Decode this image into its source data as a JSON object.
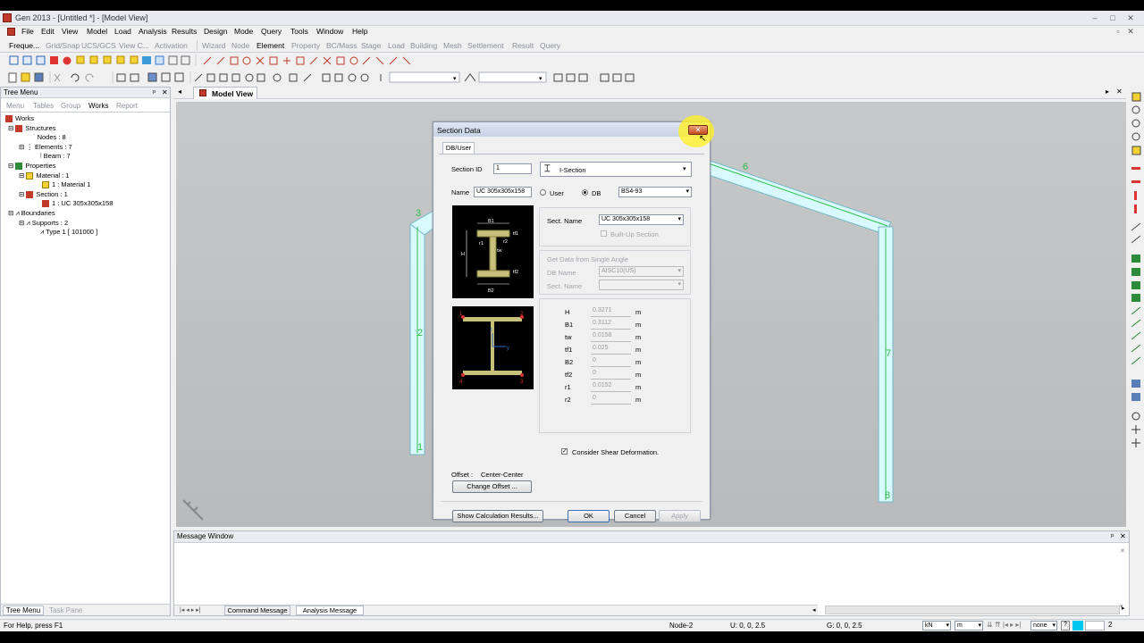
{
  "window": {
    "title": "Gen 2013 - [Untitled *] - [Model View]"
  },
  "menu": [
    "File",
    "Edit",
    "View",
    "Model",
    "Load",
    "Analysis",
    "Results",
    "Design",
    "Mode",
    "Query",
    "Tools",
    "Window",
    "Help"
  ],
  "ribbon_tabs": [
    "Freque...",
    "Grid/Snap",
    "UCS/GCS",
    "View C...",
    "Activation",
    "Wizard",
    "Node",
    "Element",
    "Property",
    "BC/Mass",
    "Stage",
    "Load",
    "Building",
    "Mesh",
    "Settlement",
    "Result",
    "Query"
  ],
  "tree": {
    "title": "Tree Menu",
    "tabs": [
      "Menu",
      "Tables",
      "Group",
      "Works",
      "Report"
    ],
    "items": [
      {
        "label": "Works",
        "level": 0
      },
      {
        "label": "Structures",
        "level": 1
      },
      {
        "label": "Nodes : 8",
        "level": 2
      },
      {
        "label": "Elements : 7",
        "level": 2
      },
      {
        "label": "Beam : 7",
        "level": 3
      },
      {
        "label": "Properties",
        "level": 1
      },
      {
        "label": "Material : 1",
        "level": 2
      },
      {
        "label": "1 : Material 1",
        "level": 3
      },
      {
        "label": "Section : 1",
        "level": 2
      },
      {
        "label": "1 : UC 305x305x158",
        "level": 3
      },
      {
        "label": "Boundaries",
        "level": 1
      },
      {
        "label": "Supports : 2",
        "level": 2
      },
      {
        "label": "Type 1 [ 101000 ]",
        "level": 3
      }
    ],
    "bottom_tabs": [
      "Tree Menu",
      "Task Pane"
    ]
  },
  "view": {
    "tab": "Model View",
    "labels": [
      "3",
      "2",
      "1",
      "7",
      "8",
      "6"
    ]
  },
  "dialog": {
    "title": "Section Data",
    "tab": "DB/User",
    "section_id_label": "Section ID",
    "section_id": "1",
    "section_type": "I-Section",
    "name_label": "Name",
    "name": "UC 305x305x158",
    "user_label": "User",
    "db_label": "DB",
    "db_value": "BS4-93",
    "sect_name_label": "Sect. Name",
    "sect_name": "UC 305x305x158",
    "builtup": "Built-Up Section",
    "single_angle": "Get Data from Single Angle",
    "db_name_label": "DB Name",
    "db_name": "AISC10(US)",
    "sect_name2_label": "Sect. Name",
    "dims": [
      {
        "name": "H",
        "value": "0.3271",
        "unit": "m"
      },
      {
        "name": "B1",
        "value": "0.3112",
        "unit": "m"
      },
      {
        "name": "tw",
        "value": "0.0158",
        "unit": "m"
      },
      {
        "name": "tf1",
        "value": "0.025",
        "unit": "m"
      },
      {
        "name": "B2",
        "value": "0",
        "unit": "m"
      },
      {
        "name": "tf2",
        "value": "0",
        "unit": "m"
      },
      {
        "name": "r1",
        "value": "0.0152",
        "unit": "m"
      },
      {
        "name": "r2",
        "value": "0",
        "unit": "m"
      }
    ],
    "diagram_labels": [
      "B1",
      "tf1",
      "r1",
      "r2",
      "H",
      "tw",
      "tf2",
      "B2"
    ],
    "axis_labels": [
      "1",
      "2",
      "3",
      "4",
      "z",
      "y"
    ],
    "shear": "Consider Shear Deformation.",
    "offset_label": "Offset :",
    "offset_value": "Center-Center",
    "change_offset": "Change Offset ...",
    "show_calc": "Show Calculation Results...",
    "ok": "OK",
    "cancel": "Cancel",
    "apply": "Apply"
  },
  "message": {
    "title": "Message Window",
    "tabs": [
      "Command Message",
      "Analysis Message"
    ]
  },
  "status": {
    "help": "For Help, press F1",
    "node": "Node-2",
    "u": "U: 0, 0, 2.5",
    "g": "G: 0, 0, 2.5",
    "unit_force": "kN",
    "unit_len": "m",
    "none": "none",
    "page": "2"
  }
}
